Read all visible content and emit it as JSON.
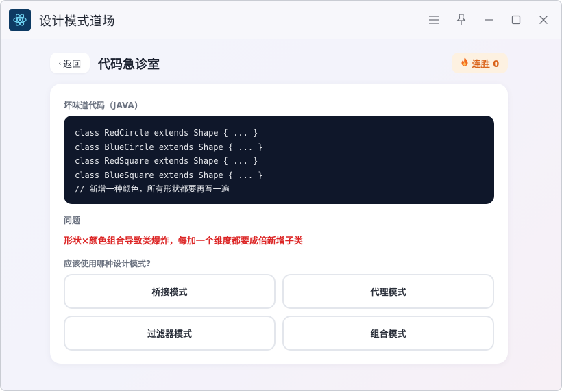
{
  "window": {
    "title": "设计模式道场"
  },
  "header": {
    "back_label": "返回",
    "page_title": "代码急诊室",
    "streak_label": "连胜 0"
  },
  "code_section": {
    "label": "坏味道代码（JAVA)",
    "lines": [
      "class RedCircle extends Shape { ... }",
      "class BlueCircle extends Shape { ... }",
      "class RedSquare extends Shape { ... }",
      "class BlueSquare extends Shape { ... }",
      "// 新增一种颜色，所有形状都要再写一遍"
    ]
  },
  "problem_section": {
    "label": "问题",
    "text": "形状×颜色组合导致类爆炸，每加一个维度都要成倍新增子类"
  },
  "question": {
    "label": "应该使用哪种设计模式?",
    "options": [
      "桥接模式",
      "代理模式",
      "过滤器模式",
      "组合模式"
    ]
  },
  "colors": {
    "accent_red": "#dc2626",
    "streak_orange": "#d9621a",
    "code_bg": "#0f172a",
    "app_icon_bg": "#0d3a63"
  },
  "icons": {
    "app": "atom-icon",
    "menu": "hamburger-menu-icon",
    "pin": "pin-icon",
    "minimize": "minimize-icon",
    "maximize": "maximize-icon",
    "close": "close-icon",
    "streak": "flame-icon"
  }
}
